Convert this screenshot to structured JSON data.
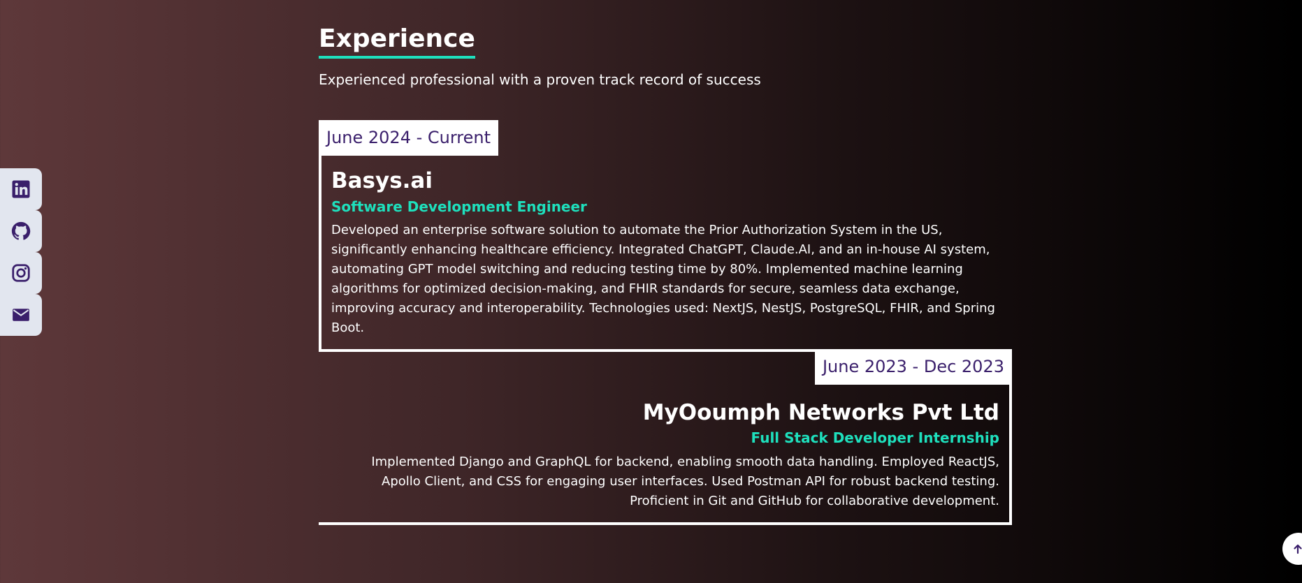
{
  "social": {
    "items": [
      {
        "icon": "linkedin-icon"
      },
      {
        "icon": "github-icon"
      },
      {
        "icon": "instagram-icon"
      },
      {
        "icon": "mail-icon"
      }
    ],
    "icon_color": "#3a1f6b",
    "background": "#e2e6ef"
  },
  "experience": {
    "heading": "Experience",
    "subtitle": "Experienced professional with a proven track record of success",
    "accent_color": "#1ee0bd",
    "entries": [
      {
        "date": "June 2024 - Current",
        "company": "Basys.ai",
        "role": "Software Development Engineer",
        "description": "Developed an enterprise software solution to automate the Prior Authorization System in the US, significantly enhancing healthcare efficiency. Integrated ChatGPT, Claude.AI, and an in-house AI system, automating GPT model switching and reducing testing time by 80%. Implemented machine learning algorithms for optimized decision-making, and FHIR standards for secure, seamless data exchange, improving accuracy and interoperability. Technologies used: NextJS, NestJS, PostgreSQL, FHIR, and Spring Boot."
      },
      {
        "date": "June 2023 - Dec 2023",
        "company": "MyOoumph Networks Pvt Ltd",
        "role": "Full Stack Developer Internship",
        "description": "Implemented Django and GraphQL for backend, enabling smooth data handling. Employed ReactJS, Apollo Client, and CSS for engaging user interfaces. Used Postman API for robust backend testing. Proficient in Git and GitHub for collaborative development."
      }
    ]
  },
  "scroll_top": {
    "icon": "arrow-up-icon"
  }
}
